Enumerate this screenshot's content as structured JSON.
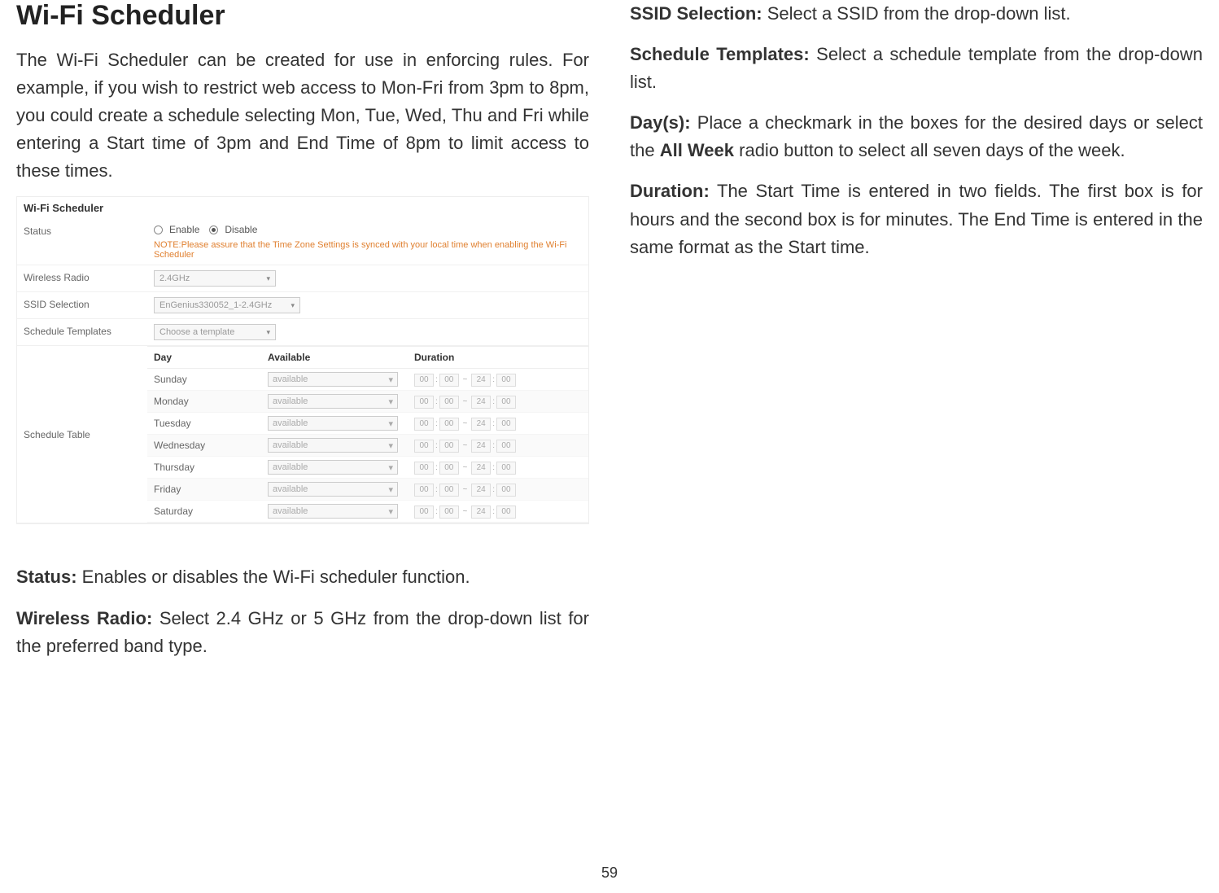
{
  "page_number": "59",
  "title": "Wi-Fi Scheduler",
  "intro": "The Wi-Fi Scheduler can be created for use in enforcing rules. For example, if you wish to restrict web access to Mon-Fri from 3pm to 8pm, you could create a schedule selecting Mon, Tue, Wed, Thu and Fri while entering a Start time of 3pm and End Time of 8pm to limit access to these times.",
  "definitions": {
    "status": {
      "term": "Status:",
      "text": " Enables or disables the Wi-Fi scheduler function."
    },
    "wireless_radio": {
      "term": "Wireless Radio:",
      "text": " Select 2.4 GHz or 5 GHz from the drop-down list for the preferred band type."
    },
    "ssid_selection": {
      "term": "SSID Selection:",
      "text": " Select a SSID from the drop-down list."
    },
    "schedule_templates": {
      "term": "Schedule Templates:",
      "text": " Select a schedule template from the drop-down list."
    },
    "days": {
      "term": "Day(s):",
      "text_before": " Place a checkmark in the boxes for the desired days or select the ",
      "bold": "All Week",
      "text_after": " radio button to select all seven days of the week."
    },
    "duration": {
      "term": "Duration:",
      "text": " The Start Time is entered in two fields. The first box is for hours and the second box is for minutes. The End Time is entered in the same format as the Start time."
    }
  },
  "panel": {
    "heading": "Wi-Fi Scheduler",
    "labels": {
      "status": "Status",
      "wireless_radio": "Wireless Radio",
      "ssid_selection": "SSID Selection",
      "schedule_templates": "Schedule Templates",
      "schedule_table": "Schedule Table"
    },
    "status_options": {
      "enable": "Enable",
      "disable": "Disable"
    },
    "note_label": "NOTE:",
    "note_text": "Please assure that the Time Zone Settings is synced with your local time when enabling the Wi-Fi Scheduler",
    "wireless_radio_value": "2.4GHz",
    "ssid_value": "EnGenius330052_1-2.4GHz",
    "template_value": "Choose a template",
    "table": {
      "headers": {
        "day": "Day",
        "available": "Available",
        "duration": "Duration"
      },
      "available_value": "available",
      "time": {
        "sh": "00",
        "sm": "00",
        "eh": "24",
        "em": "00",
        "colon": ":",
        "tilde": "~"
      },
      "days": [
        "Sunday",
        "Monday",
        "Tuesday",
        "Wednesday",
        "Thursday",
        "Friday",
        "Saturday"
      ]
    }
  }
}
